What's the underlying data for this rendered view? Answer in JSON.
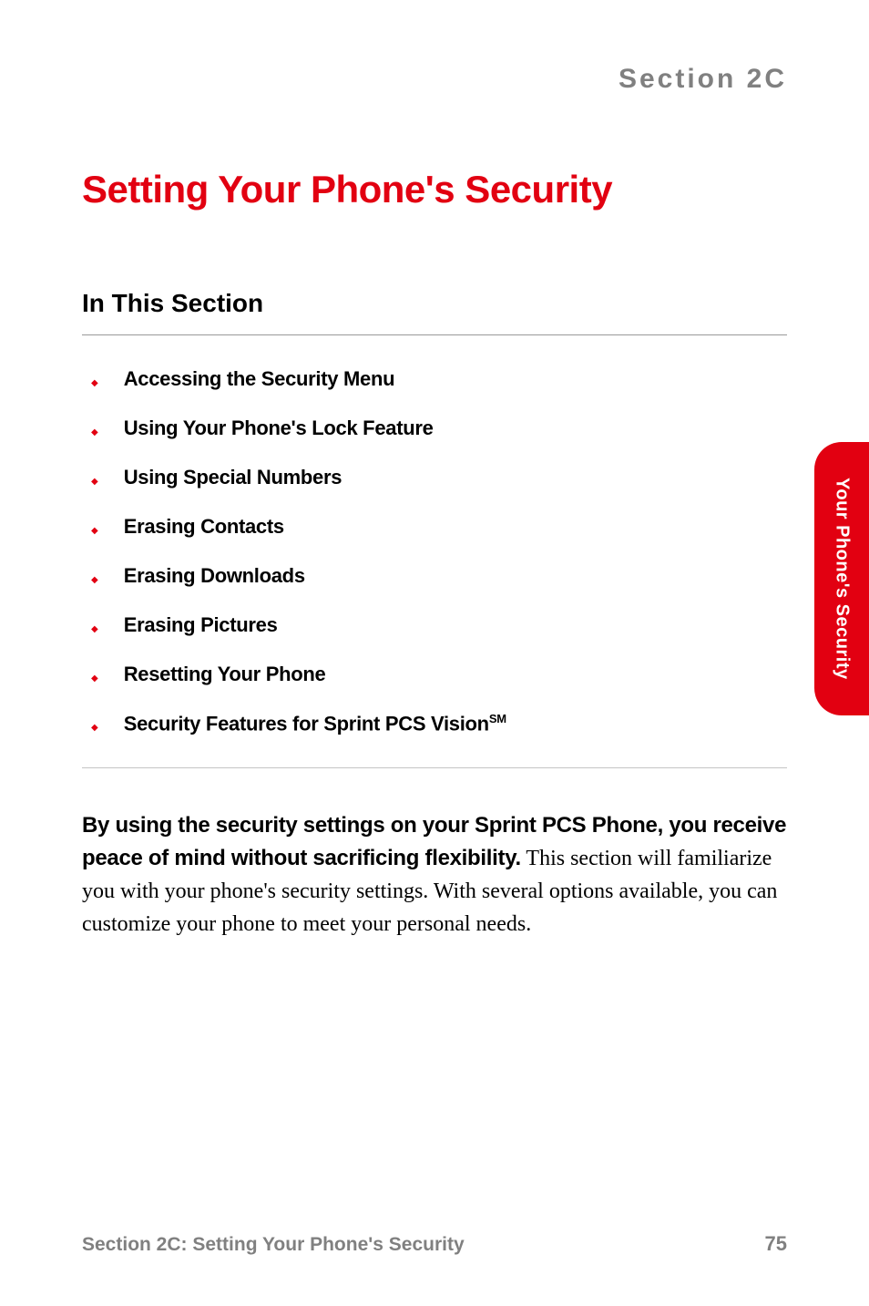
{
  "section_label": "Section 2C",
  "main_title": "Setting Your Phone's Security",
  "subsection_title": "In This Section",
  "toc_items": [
    "Accessing the Security Menu",
    "Using Your Phone's Lock Feature",
    "Using Special Numbers",
    "Erasing Contacts",
    "Erasing Downloads",
    "Erasing Pictures",
    "Resetting Your Phone",
    "Security Features for Sprint PCS Vision"
  ],
  "toc_superscript": "SM",
  "intro_bold": "By using the security settings on your Sprint PCS Phone, you receive peace of mind without sacrificing flexibility.",
  "intro_body": " This section will familiarize you with your phone's security settings. With several options available, you can customize your phone to meet your personal needs.",
  "side_tab": "Your Phone's Security",
  "footer_left": "Section 2C: Setting Your Phone's Security",
  "page_number": "75",
  "colors": {
    "accent_red": "#e20011",
    "gray_text": "#808080"
  }
}
